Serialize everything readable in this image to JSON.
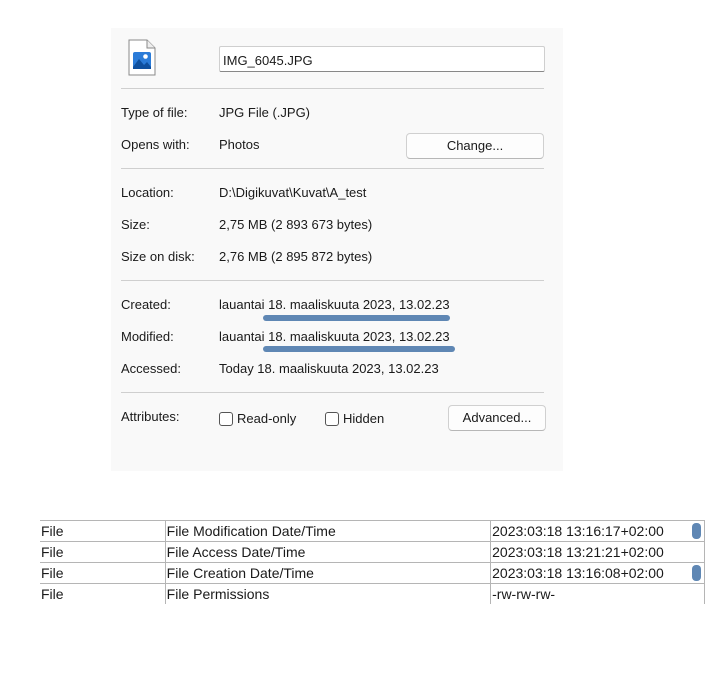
{
  "general": {
    "file_name": "IMG_6045.JPG",
    "type_label": "Type of file:",
    "type_value": "JPG File (.JPG)",
    "opens_label": "Opens with:",
    "opens_value": "Photos",
    "change_button": "Change..."
  },
  "location": {
    "location_label": "Location:",
    "location_value": "D:\\Digikuvat\\Kuvat\\A_test",
    "size_label": "Size:",
    "size_value": "2,75 MB (2 893 673 bytes)",
    "size_on_disk_label": "Size on disk:",
    "size_on_disk_value": "2,76 MB (2 895 872 bytes)"
  },
  "dates": {
    "created_label": "Created:",
    "created_value": "lauantai 18. maaliskuuta 2023, 13.02.23",
    "modified_label": "Modified:",
    "modified_value": "lauantai 18. maaliskuuta 2023, 13.02.23",
    "accessed_label": "Accessed:",
    "accessed_value": "Today 18. maaliskuuta 2023, 13.02.23"
  },
  "attributes": {
    "label": "Attributes:",
    "readonly_label": "Read-only",
    "readonly_checked": false,
    "hidden_label": "Hidden",
    "hidden_checked": false,
    "advanced_button": "Advanced..."
  },
  "icons": {
    "file": "image-file-icon"
  },
  "colors": {
    "highlight": "#5f87b4",
    "panel_bg": "#f9f9f9"
  },
  "metadata_table": {
    "rows": [
      {
        "group": "File",
        "tag": "File Modification Date/Time",
        "value": "2023:03:18 13:16:17+02:00"
      },
      {
        "group": "File",
        "tag": "File Access Date/Time",
        "value": "2023:03:18 13:21:21+02:00"
      },
      {
        "group": "File",
        "tag": "File Creation Date/Time",
        "value": "2023:03:18 13:16:08+02:00"
      },
      {
        "group": "File",
        "tag": "File Permissions",
        "value": "-rw-rw-rw-"
      }
    ]
  }
}
